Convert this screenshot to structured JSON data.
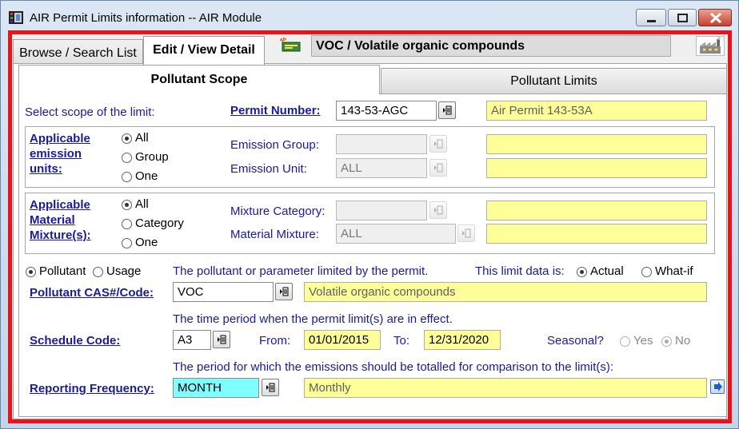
{
  "window": {
    "title": "AIR Permit Limits information -- AIR Module"
  },
  "outer_tabs": {
    "browse": "Browse / Search List",
    "edit": "Edit / View Detail"
  },
  "header": {
    "title": "VOC / Volatile organic compounds"
  },
  "inner_tabs": {
    "scope": "Pollutant Scope",
    "limits": "Pollutant Limits"
  },
  "scope": {
    "select_label": "Select scope of the limit:",
    "permit_label": "Permit Number:",
    "permit_value": "143-53-AGC",
    "permit_desc": "Air Permit 143-53A"
  },
  "emission": {
    "heading_lines": [
      "Applicable",
      "emission",
      "units:"
    ],
    "options": [
      "All",
      "Group",
      "One"
    ],
    "selected": "All",
    "group_label": "Emission Group:",
    "group_value": "",
    "group_desc": "",
    "unit_label": "Emission Unit:",
    "unit_value": "ALL",
    "unit_desc": ""
  },
  "material": {
    "heading_lines": [
      "Applicable",
      "Material",
      "Mixture(s):"
    ],
    "options": [
      "All",
      "Category",
      "One"
    ],
    "selected": "All",
    "category_label": "Mixture Category:",
    "category_value": "",
    "category_desc": "",
    "mixture_label": "Material Mixture:",
    "mixture_value": "ALL",
    "mixture_desc": ""
  },
  "pollutant": {
    "type_options": [
      "Pollutant",
      "Usage"
    ],
    "type_selected": "Pollutant",
    "hint": "The pollutant or parameter limited by the permit.",
    "limit_data_label": "This limit data is:",
    "limit_data_options": [
      "Actual",
      "What-if"
    ],
    "limit_data_selected": "Actual",
    "cas_label": "Pollutant CAS#/Code:",
    "cas_value": "VOC",
    "cas_desc": "Volatile organic compounds"
  },
  "schedule": {
    "hint": "The time period when the permit limit(s) are in effect.",
    "label": "Schedule Code:",
    "value": "A3",
    "from_label": "From:",
    "from_value": "01/01/2015",
    "to_label": "To:",
    "to_value": "12/31/2020",
    "seasonal_label": "Seasonal?",
    "seasonal_options": [
      "Yes",
      "No"
    ],
    "seasonal_selected": "No"
  },
  "reporting": {
    "hint": "The period for which the emissions should be totalled for comparison to the limit(s):",
    "label": "Reporting Frequency:",
    "value": "MONTH",
    "desc": "Monthly"
  },
  "colors": {
    "frame_border": "#e8141c",
    "link_blue": "#1a1a9c",
    "readonly_yellow": "#ffff99",
    "highlight_cyan": "#80ffff"
  }
}
